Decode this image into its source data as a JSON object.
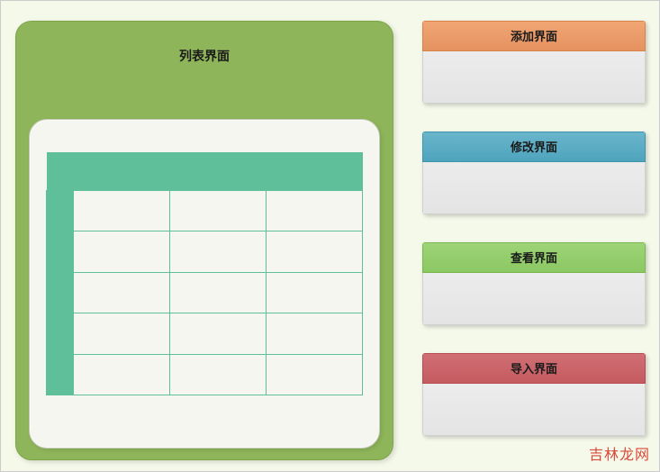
{
  "main_panel": {
    "title": "列表界面",
    "table": {
      "columns": 3,
      "rows": 5
    }
  },
  "side_cards": [
    {
      "label": "添加界面",
      "color": "orange"
    },
    {
      "label": "修改界面",
      "color": "blue"
    },
    {
      "label": "查看界面",
      "color": "green"
    },
    {
      "label": "导入界面",
      "color": "red"
    }
  ],
  "watermark": "吉林龙网"
}
